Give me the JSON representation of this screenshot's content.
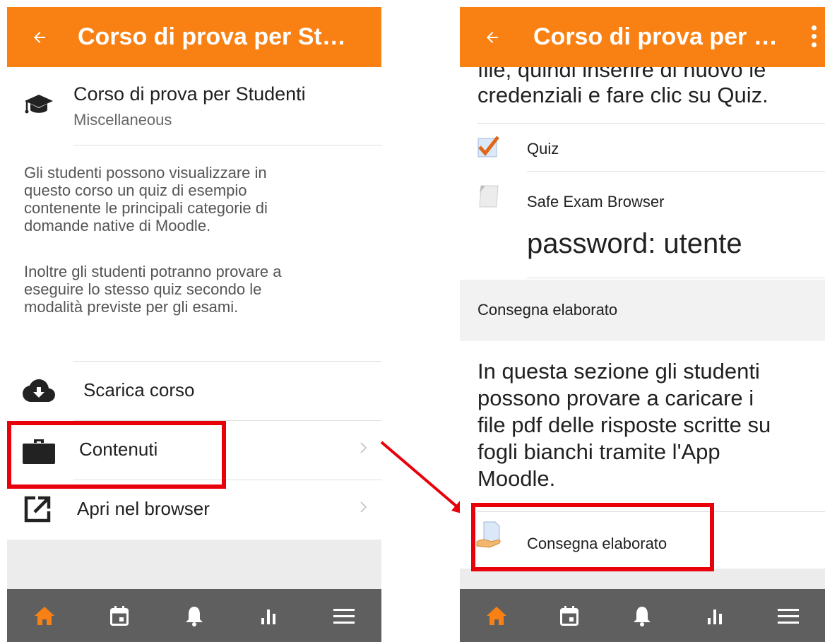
{
  "left": {
    "app_title": "Corso di prova per St…",
    "course_title": "Corso di prova per Studenti",
    "course_category": "Miscellaneous",
    "summary_lines": [
      "Gli studenti possono visualizzare in",
      "questo corso un quiz di esempio",
      "contenente le principali categorie di",
      "domande native di Moodle."
    ],
    "summary2_lines": [
      "Inoltre gli studenti potranno provare a",
      "eseguire lo stesso quiz secondo le",
      "modalità previste per gli esami."
    ],
    "actions": {
      "download": "Scarica corso",
      "contents": "Contenuti",
      "open_browser": "Apri nel browser"
    }
  },
  "right": {
    "app_title": "Corso di prova per …",
    "clipped_text": "file, quindi inserire di nuovo le",
    "credentials_text": "credenziali e fare clic su Quiz.",
    "items": {
      "quiz": "Quiz",
      "seb": "Safe Exam Browser",
      "password": "password: utente",
      "section": "Consegna elaborato",
      "assign": "Consegna elaborato"
    },
    "description_lines": [
      "In questa sezione gli studenti",
      "possono provare a caricare i",
      "file pdf delle risposte scritte su",
      "fogli bianchi tramite l'App",
      "Moodle."
    ]
  },
  "tabs": [
    "home-icon",
    "calendar-icon",
    "bell-icon",
    "grades-icon",
    "menu-icon"
  ],
  "colors": {
    "brand": "#f98012",
    "tabbar": "#5f5f5f",
    "highlight": "#e8000a",
    "active_tab": "#f98012",
    "inactive_tab": "#ffffff"
  }
}
